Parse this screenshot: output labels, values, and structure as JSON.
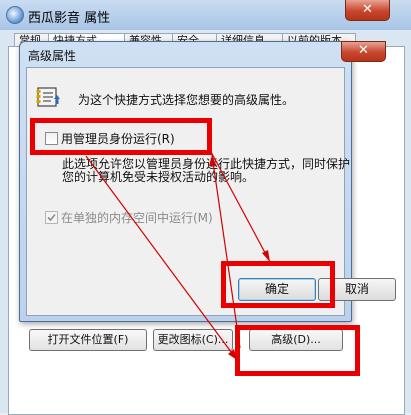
{
  "outer_window": {
    "title": "西瓜影音 属性",
    "close_glyph": "✕",
    "tabs": [
      "常规",
      "快捷方式",
      "兼容性",
      "安全",
      "详细信息",
      "以前的版本"
    ],
    "buttons": {
      "open_location": "打开文件位置(F)",
      "change_icon": "更改图标(C)...",
      "advanced": "高级(D)..."
    }
  },
  "dialog": {
    "title": "高级属性",
    "close_glyph": "✕",
    "description": "为这个快捷方式选择您想要的高级属性。",
    "run_as_admin": {
      "label": "用管理员身份运行(R)",
      "checked": false
    },
    "explanation_line1": "此选项允许您以管理员身份运行此快捷方式，同时保护",
    "explanation_line2": "您的计算机免受未授权活动的影响。",
    "separate_memory": {
      "label": "在单独的内存空间中运行(M)",
      "checked": true,
      "enabled": false
    },
    "ok_label": "确定",
    "cancel_label": "取消"
  },
  "colors": {
    "annotation_red": "#ea0000",
    "titlebar": "#bcd2ec",
    "close_red": "#c8462e"
  }
}
